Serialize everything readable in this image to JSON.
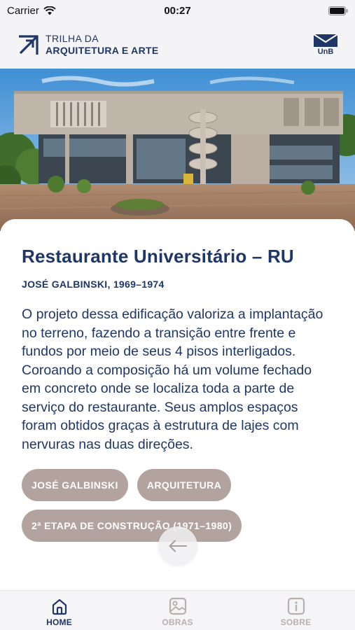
{
  "status_bar": {
    "carrier": "Carrier",
    "time": "00:27"
  },
  "header": {
    "logo_line1": "TRILHA DA",
    "logo_line2": "ARQUITETURA E ARTE",
    "unb_label": "UnB"
  },
  "hero": {
    "image_alt": "Restaurante Universitário building photo"
  },
  "artwork": {
    "title": "Restaurante Universitário – RU",
    "subtitle": "JOSÉ GALBINSKI, 1969–1974",
    "description": "O projeto dessa edificação valoriza a implantação no terreno, fazendo a transição entre frente e fundos por meio de seus 4 pisos interligados. Coroando a composição há um volume fechado em concreto onde se localiza toda a parte de serviço do restaurante. Seus amplos espaços foram obtidos graças à estrutura de lajes com nervuras nas duas direções.",
    "tags": [
      "JOSÉ GALBINSKI",
      "ARQUITETURA",
      "2ª ETAPA DE CONSTRUÇÃO (1971–1980)"
    ]
  },
  "tabbar": {
    "tabs": [
      {
        "label": "HOME",
        "icon": "home-icon",
        "active": true
      },
      {
        "label": "OBRAS",
        "icon": "image-icon",
        "active": false
      },
      {
        "label": "SOBRE",
        "icon": "info-icon",
        "active": false
      }
    ]
  },
  "colors": {
    "primary": "#1f3766",
    "tag_bg": "#b3a39e",
    "inactive": "#b9b0ae"
  }
}
